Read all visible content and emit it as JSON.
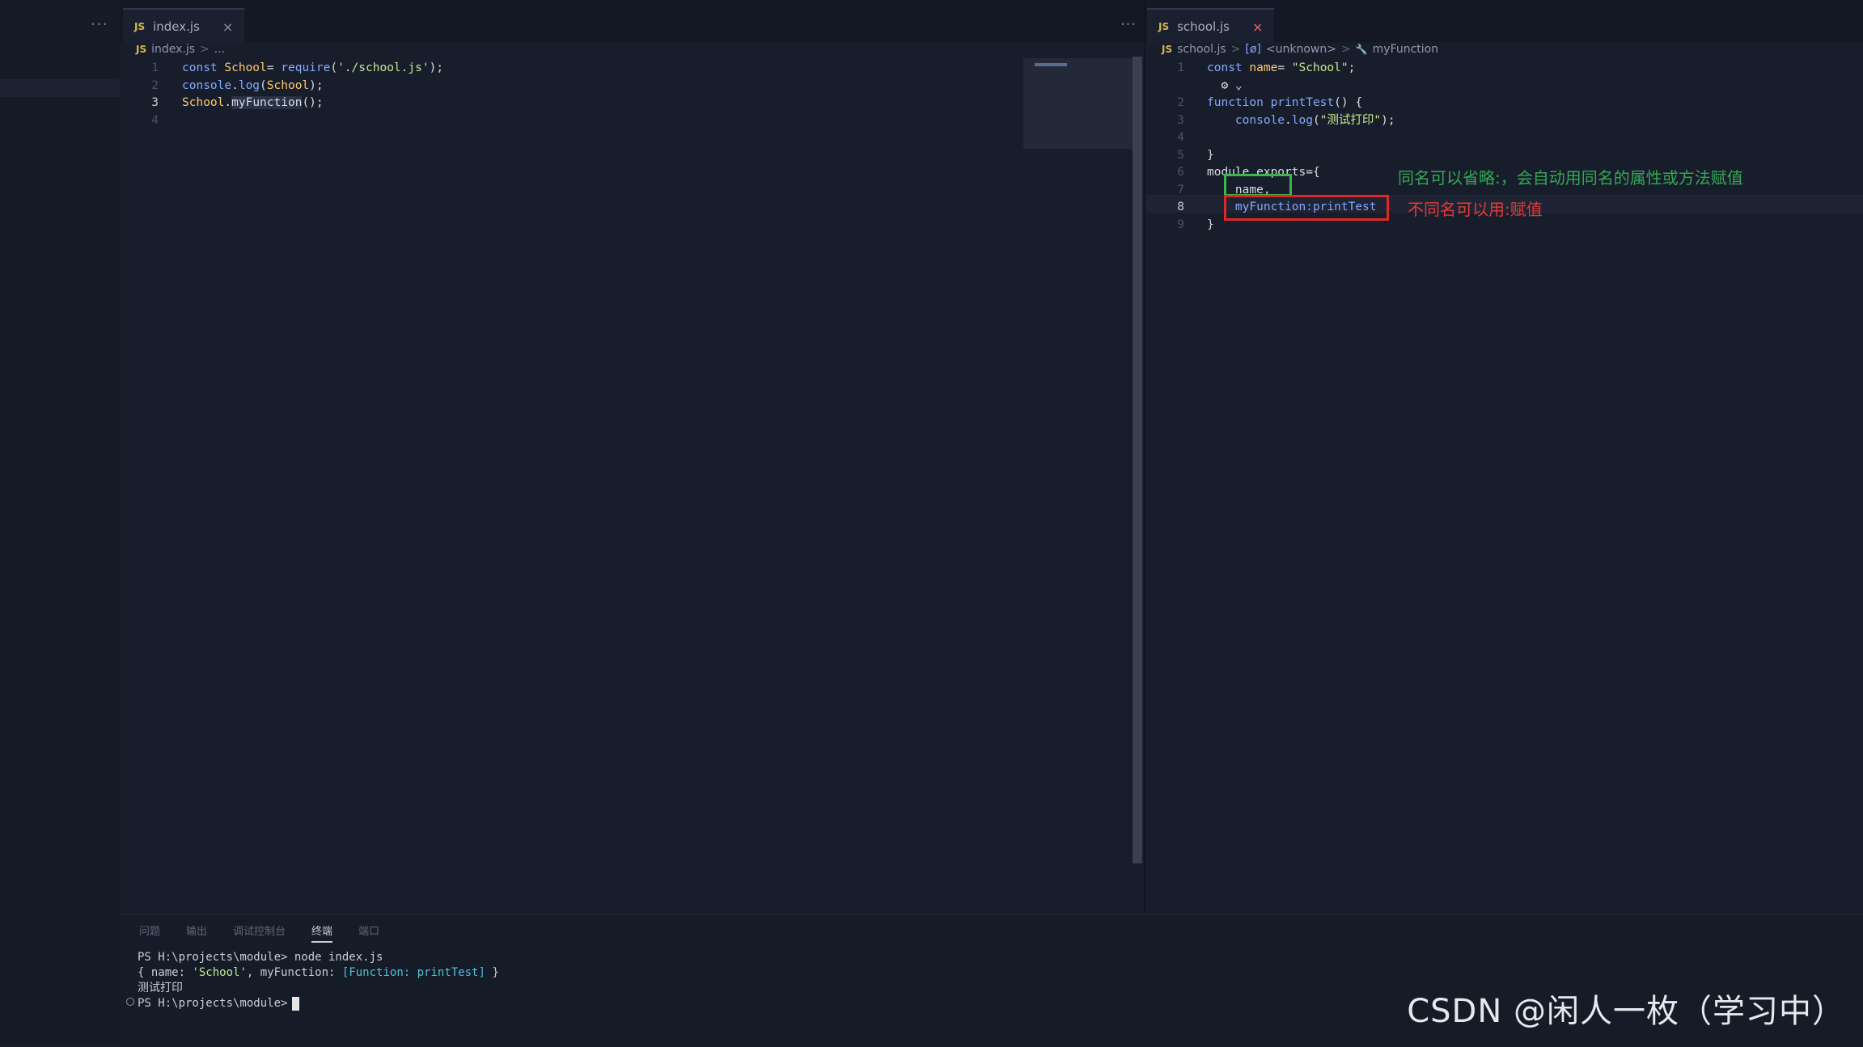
{
  "sidebar": {
    "more": "···"
  },
  "left_editor": {
    "tab": {
      "badge": "JS",
      "label": "index.js",
      "close": "×"
    },
    "more": "···",
    "breadcrumb": {
      "badge": "JS",
      "file": "index.js",
      "sep": ">",
      "rest": "..."
    },
    "lines": [
      {
        "n": "1",
        "parts": [
          [
            "kw",
            "const "
          ],
          [
            "id",
            "School"
          ],
          [
            "",
            "= "
          ],
          [
            "fn",
            "require"
          ],
          [
            "",
            "("
          ],
          [
            "str",
            "'./school.js'"
          ],
          [
            "",
            ");"
          ]
        ]
      },
      {
        "n": "2",
        "parts": [
          [
            "fn",
            "console"
          ],
          [
            "",
            "."
          ],
          [
            "fn",
            "log"
          ],
          [
            "",
            "("
          ],
          [
            "id",
            "School"
          ],
          [
            "",
            ");"
          ]
        ]
      },
      {
        "n": "3",
        "active": true,
        "parts": [
          [
            "id",
            "School"
          ],
          [
            "",
            "."
          ],
          [
            "hl",
            "myFunction"
          ],
          [
            "",
            "();"
          ]
        ]
      },
      {
        "n": "4",
        "parts": []
      }
    ]
  },
  "right_editor": {
    "tab": {
      "badge": "JS",
      "label": "school.js",
      "close": "×"
    },
    "breadcrumb": {
      "badge": "JS",
      "file": "school.js",
      "sep": ">",
      "sym1_icon": "[ø]",
      "sym1": "<unknown>",
      "sym2_icon": "🔧",
      "sym2": "myFunction"
    },
    "lines": [
      {
        "n": "1",
        "parts": [
          [
            "kw",
            "const "
          ],
          [
            "id",
            "name"
          ],
          [
            "",
            "= "
          ],
          [
            "str",
            "\"School\""
          ],
          [
            "",
            ";"
          ]
        ]
      },
      {
        "n": "",
        "parts": [
          [
            "",
            "  ⚙ ⌄"
          ]
        ]
      },
      {
        "n": "2",
        "parts": [
          [
            "kw",
            "function "
          ],
          [
            "fn",
            "printTest"
          ],
          [
            "",
            "() {"
          ]
        ]
      },
      {
        "n": "3",
        "parts": [
          [
            "",
            "    "
          ],
          [
            "fn",
            "console"
          ],
          [
            "",
            "."
          ],
          [
            "fn",
            "log"
          ],
          [
            "",
            "("
          ],
          [
            "str",
            "\"测试打印\""
          ],
          [
            "",
            ");"
          ]
        ]
      },
      {
        "n": "4",
        "parts": []
      },
      {
        "n": "5",
        "parts": [
          [
            "",
            "}"
          ]
        ]
      },
      {
        "n": "6",
        "parts": [
          [
            "",
            "module.exports={"
          ]
        ]
      },
      {
        "n": "7",
        "parts": [
          [
            "",
            "    name,"
          ]
        ]
      },
      {
        "n": "8",
        "active": true,
        "parts": [
          [
            "",
            "    "
          ],
          [
            "fn",
            "myFunction:printTest"
          ]
        ]
      },
      {
        "n": "9",
        "parts": [
          [
            "",
            "}"
          ]
        ]
      }
    ],
    "annotations": {
      "green": "同名可以省略:，会自动用同名的属性或方法赋值",
      "red": "不同名可以用:赋值"
    }
  },
  "panel": {
    "tabs": [
      "问题",
      "输出",
      "调试控制台",
      "终端",
      "端口"
    ],
    "active_tab": 3,
    "terminal": {
      "line1": "PS H:\\projects\\module> node index.js",
      "line2_pre": "{ name: ",
      "line2_str": "'School'",
      "line2_mid": ", myFunction: ",
      "line2_fn": "[Function: printTest]",
      "line2_post": " }",
      "line3": "测试打印",
      "line4": "PS H:\\projects\\module>"
    }
  },
  "watermark": "CSDN @闲人一枚（学习中）",
  "colors": {
    "bg": "#171c2a",
    "keyword": "#82aaff",
    "string": "#c3e88d",
    "identifier": "#ffcb6b",
    "green_box": "#3cb44a",
    "red_box": "#e02626"
  }
}
